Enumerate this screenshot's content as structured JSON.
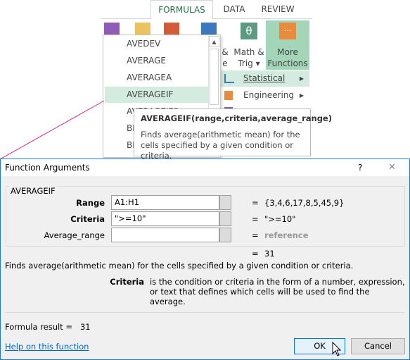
{
  "ribbon": {
    "tabs": [
      {
        "label": "FORMULAS",
        "active": true
      },
      {
        "label": "DATA"
      },
      {
        "label": "REVIEW"
      }
    ],
    "groups": {
      "partial_label_line1": "&",
      "partial_label_line2": "e",
      "math_trig_line1": "Math &",
      "math_trig_line2": "Trig",
      "more_functions_line1": "More",
      "more_functions_line2": "Functions"
    },
    "accent": "#217346"
  },
  "function_list": {
    "items": [
      "AVEDEV",
      "AVERAGE",
      "AVERAGEA",
      "AVERAGEIF",
      "AVERAGEIFS",
      "BI",
      "BI"
    ],
    "selected": "AVERAGEIF"
  },
  "more_functions_menu": {
    "items": [
      {
        "label": "Statistical",
        "selected": true
      },
      {
        "label": "Engineering"
      }
    ]
  },
  "tooltip": {
    "signature": "AVERAGEIF(range,criteria,average_range)",
    "description": "Finds average(arithmetic mean) for the cells specified by a given condition or criteria."
  },
  "dialog": {
    "title": "Function Arguments",
    "help_glyph": "?",
    "close_glyph": "✕",
    "function_name": "AVERAGEIF",
    "args": [
      {
        "label": "Range",
        "value": "A1:H1",
        "result": "{3,4,6,17,8,5,45,9}",
        "bold": true
      },
      {
        "label": "Criteria",
        "value": "\">=10\"",
        "result": "\">=10\"",
        "bold": true
      },
      {
        "label": "Average_range",
        "value": "",
        "result": "reference",
        "bold": false
      }
    ],
    "equals": "=",
    "result": "31",
    "description": "Finds average(arithmetic mean) for the cells specified by a given condition or criteria.",
    "arg_help_name": "Criteria",
    "arg_help_text": "is the condition or criteria in the form of a number, expression, or text that defines which cells will be used to find the average.",
    "formula_result_label": "Formula result =",
    "formula_result_value": "31",
    "help_link": "Help on this function",
    "ok_label": "OK",
    "cancel_label": "Cancel"
  }
}
